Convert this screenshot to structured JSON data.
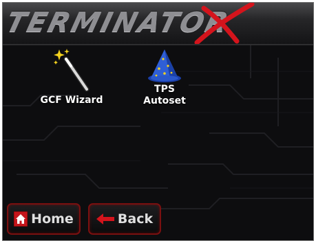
{
  "banner": {
    "title": "TERMINATOR",
    "title_suffix": "X"
  },
  "apps": [
    {
      "label": "GCF Wizard",
      "icon": "magic-wand-icon"
    },
    {
      "label_line1": "TPS",
      "label_line2": "Autoset",
      "icon": "wizard-hat-icon"
    }
  ],
  "nav": {
    "home_label": "Home",
    "back_label": "Back",
    "home_icon": "home-icon",
    "back_icon": "back-arrow-icon"
  },
  "colors": {
    "background": "#0d0d0f",
    "accent_red": "#d4141c",
    "button_border": "#7b1010",
    "text": "#ffffff"
  }
}
